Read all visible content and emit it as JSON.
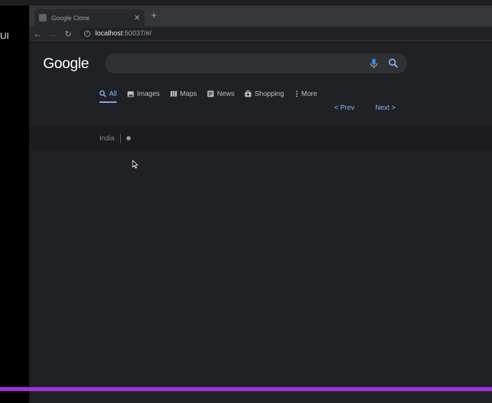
{
  "left_panel": {
    "text": "UI"
  },
  "browser": {
    "tab": {
      "title": "Google Clone",
      "close": "✕",
      "new_tab": "+"
    },
    "toolbar": {
      "back": "←",
      "forward": "→",
      "reload": "↻",
      "url_host": "localhost",
      "url_rest": ":50037/#/"
    }
  },
  "page": {
    "logo": "Google",
    "search": {
      "value": "",
      "placeholder": ""
    },
    "tabs": [
      {
        "label": "All",
        "icon": "search-icon",
        "active": true
      },
      {
        "label": "Images",
        "icon": "image-icon"
      },
      {
        "label": "Maps",
        "icon": "map-icon"
      },
      {
        "label": "News",
        "icon": "news-icon"
      },
      {
        "label": "Shopping",
        "icon": "shopping-icon"
      },
      {
        "label": "More",
        "icon": "more-vertical-icon"
      }
    ],
    "pager": {
      "prev": "< Prev",
      "next": "Next >"
    },
    "footer": {
      "country": "India"
    }
  },
  "colors": {
    "accent": "#8ab4f8",
    "background": "#202124",
    "searchbox": "#303134",
    "progress": "#9b30d9"
  }
}
